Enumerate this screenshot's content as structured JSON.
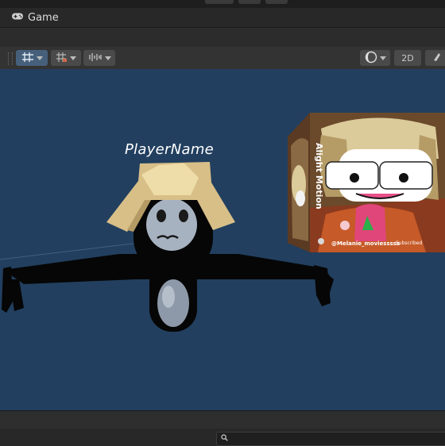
{
  "window": {
    "tab_title": "Game",
    "tab_icon": "gamepad-icon"
  },
  "toolbar": {
    "buttons": [
      {
        "name": "grid-snapping",
        "icon": "grid-snap-icon",
        "active": true
      },
      {
        "name": "grid-visibility",
        "icon": "grid-icon",
        "active": false
      },
      {
        "name": "audio-effects",
        "icon": "waveform-icon",
        "active": false
      },
      {
        "name": "draw-mode",
        "icon": "shading-sphere-icon",
        "active": false
      },
      {
        "name": "mode-2d",
        "label": "2D",
        "active": false
      },
      {
        "name": "lighting",
        "icon": "light-icon",
        "active": false
      }
    ],
    "mode_2d_label": "2D"
  },
  "scene": {
    "background_color": "#223f5f",
    "player_name": "PlayerName",
    "cube_texture": {
      "vertical_text": "Alight Motion",
      "handle": "@Melanie_moviesssss",
      "badge": "Subscribed"
    }
  },
  "statusbar": {
    "search_icon": "search-icon"
  }
}
